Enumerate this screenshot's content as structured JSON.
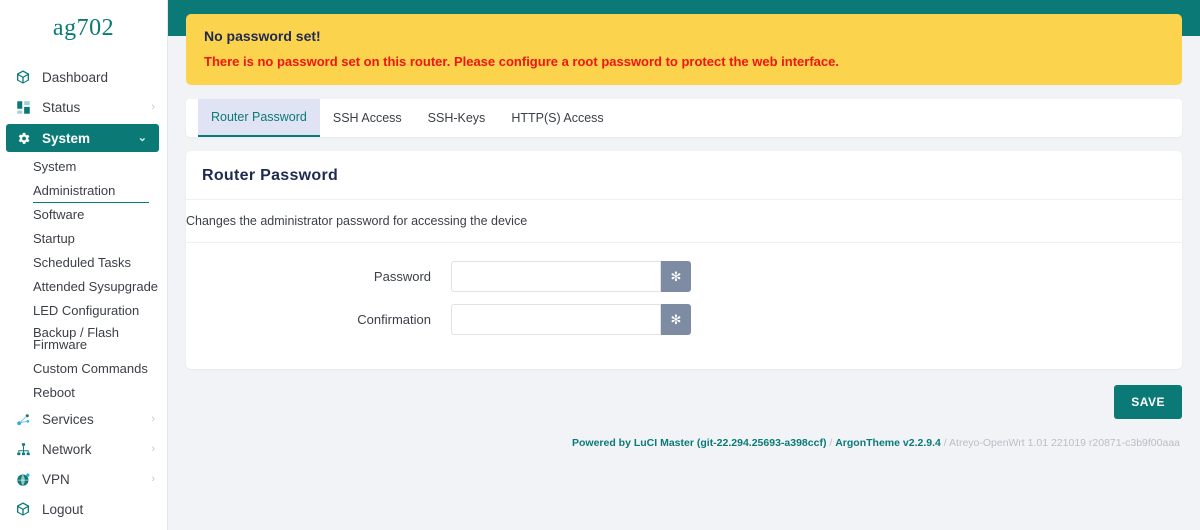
{
  "brand": {
    "name": "ag702"
  },
  "sidebar": {
    "items": [
      {
        "label": "Dashboard",
        "icon": "cube-icon",
        "chevron": "",
        "active": false
      },
      {
        "label": "Status",
        "icon": "grid-blocks-icon",
        "chevron": "›",
        "active": false
      },
      {
        "label": "System",
        "icon": "gear-icon",
        "chevron": "⌄",
        "active": true
      },
      {
        "label": "Services",
        "icon": "nodes-icon",
        "chevron": "›",
        "active": false
      },
      {
        "label": "Network",
        "icon": "sitemap-icon",
        "chevron": "›",
        "active": false
      },
      {
        "label": "VPN",
        "icon": "globe-icon",
        "chevron": "›",
        "active": false
      },
      {
        "label": "Logout",
        "icon": "cube-icon",
        "chevron": "",
        "active": false
      }
    ],
    "system_submenu": [
      {
        "label": "System",
        "selected": false
      },
      {
        "label": "Administration",
        "selected": true
      },
      {
        "label": "Software",
        "selected": false
      },
      {
        "label": "Startup",
        "selected": false
      },
      {
        "label": "Scheduled Tasks",
        "selected": false
      },
      {
        "label": "Attended Sysupgrade",
        "selected": false
      },
      {
        "label": "LED Configuration",
        "selected": false
      },
      {
        "label": "Backup / Flash Firmware",
        "selected": false
      },
      {
        "label": "Custom Commands",
        "selected": false
      },
      {
        "label": "Reboot",
        "selected": false
      }
    ]
  },
  "alert": {
    "title": "No password set!",
    "message": "There is no password set on this router. Please configure a root password to protect the web interface."
  },
  "tabs": [
    {
      "label": "Router Password",
      "active": true
    },
    {
      "label": "SSH Access",
      "active": false
    },
    {
      "label": "SSH-Keys",
      "active": false
    },
    {
      "label": "HTTP(S) Access",
      "active": false
    }
  ],
  "card": {
    "title": "Router Password",
    "description": "Changes the administrator password for accessing the device",
    "fields": [
      {
        "label": "Password",
        "value": "",
        "placeholder": "",
        "reveal_glyph": "✻"
      },
      {
        "label": "Confirmation",
        "value": "",
        "placeholder": "",
        "reveal_glyph": "✻"
      }
    ]
  },
  "actions": {
    "save_label": "SAVE"
  },
  "footer": {
    "powered": "Powered by LuCI Master (git-22.294.25693-a398ccf)",
    "sep1": " / ",
    "theme": "ArgonTheme v2.2.9.4",
    "sep2": " / ",
    "firmware": "Atreyo-OpenWrt 1.01 221019 r20871-c3b9f00aaa"
  },
  "colors": {
    "accent": "#0b7a77",
    "warning_bg": "#fcd34d",
    "warning_text": "#ef1515",
    "page_bg": "#f1f3f6",
    "reveal_btn": "#7e8ca3"
  }
}
